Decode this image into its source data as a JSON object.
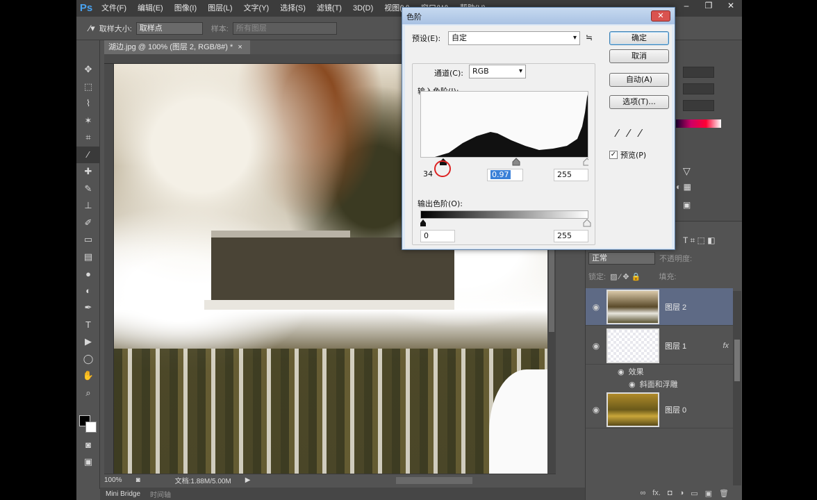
{
  "app": {
    "logo": "Ps",
    "menu": [
      "文件(F)",
      "编辑(E)",
      "图像(I)",
      "图层(L)",
      "文字(Y)",
      "选择(S)",
      "滤镜(T)",
      "3D(D)",
      "视图(V)",
      "窗口(W)",
      "帮助(H)"
    ],
    "window_controls": [
      "–",
      "❐",
      "✕"
    ]
  },
  "options_bar": {
    "tool_icon": "eyedropper-icon",
    "sample_size_label": "取样大小:",
    "sample_size_value": "取样点",
    "sample_label": "样本:",
    "sample_value": "所有图层"
  },
  "document": {
    "tab_title": "湖边.jpg @ 100% (图层 2, RGB/8#) *",
    "tab_close": "×",
    "zoom": "100%",
    "doc_size": "文档:1.88M/5.00M"
  },
  "bottom_tabs": [
    "Mini Bridge",
    "时间轴"
  ],
  "tools": [
    "move-icon",
    "marquee-icon",
    "lasso-icon",
    "magic-wand-icon",
    "crop-icon",
    "eyedropper-icon",
    "healing-icon",
    "brush-icon",
    "stamp-icon",
    "history-brush-icon",
    "eraser-icon",
    "gradient-icon",
    "blur-icon",
    "dodge-icon",
    "pen-icon",
    "type-icon",
    "path-select-icon",
    "shape-icon",
    "hand-icon",
    "zoom-icon"
  ],
  "tool_glyphs": [
    "✥",
    "⬚",
    "⌇",
    "✶",
    "⌗",
    "⁄",
    "✚",
    "✎",
    "⊥",
    "✐",
    "▭",
    "▤",
    "●",
    "◐",
    "✒",
    "T",
    "▶",
    "◯",
    "✋",
    "⌕"
  ],
  "levels_dialog": {
    "title": "色阶",
    "close": "✕",
    "preset_label": "预设(E):",
    "preset_value": "自定",
    "preset_menu_icon": "≒",
    "channel_label": "通道(C):",
    "channel_value": "RGB",
    "input_label": "输入色阶(I):",
    "input_black": "34",
    "input_gamma": "0.97",
    "input_white": "255",
    "output_label": "输出色阶(O):",
    "output_black": "0",
    "output_white": "255",
    "buttons": {
      "ok": "确定",
      "cancel": "取消",
      "auto": "自动(A)",
      "options": "选项(T)..."
    },
    "preview_label": "预览(P)",
    "preview_checked": "✓",
    "input_slider_positions": {
      "black": 34,
      "gamma": 0.97,
      "white": 255
    }
  },
  "layers_panel": {
    "blend_mode": "正常",
    "opacity_label": "不透明度:",
    "lock_label": "锁定:",
    "fill_label": "填充:",
    "layers": [
      {
        "name": "图层 2",
        "selected": true
      },
      {
        "name": "图层 1",
        "selected": false,
        "fx": "fx"
      },
      {
        "name": "图层 0",
        "selected": false
      }
    ],
    "effects_label": "效果",
    "effect_item": "斜面和浮雕",
    "footer_icons": [
      "link-icon",
      "fx-icon",
      "mask-icon",
      "adjustment-icon",
      "group-icon",
      "new-layer-icon",
      "trash-icon"
    ],
    "footer_glyphs": [
      "∞",
      "fx.",
      "◘",
      "◑",
      "▭",
      "▣",
      "🗑"
    ]
  },
  "colors": {
    "ps_bg": "#535353",
    "dialog_bg": "#f0f0f0",
    "selection_blue": "#3a80d8",
    "layer_selected": "#5e6a85"
  }
}
